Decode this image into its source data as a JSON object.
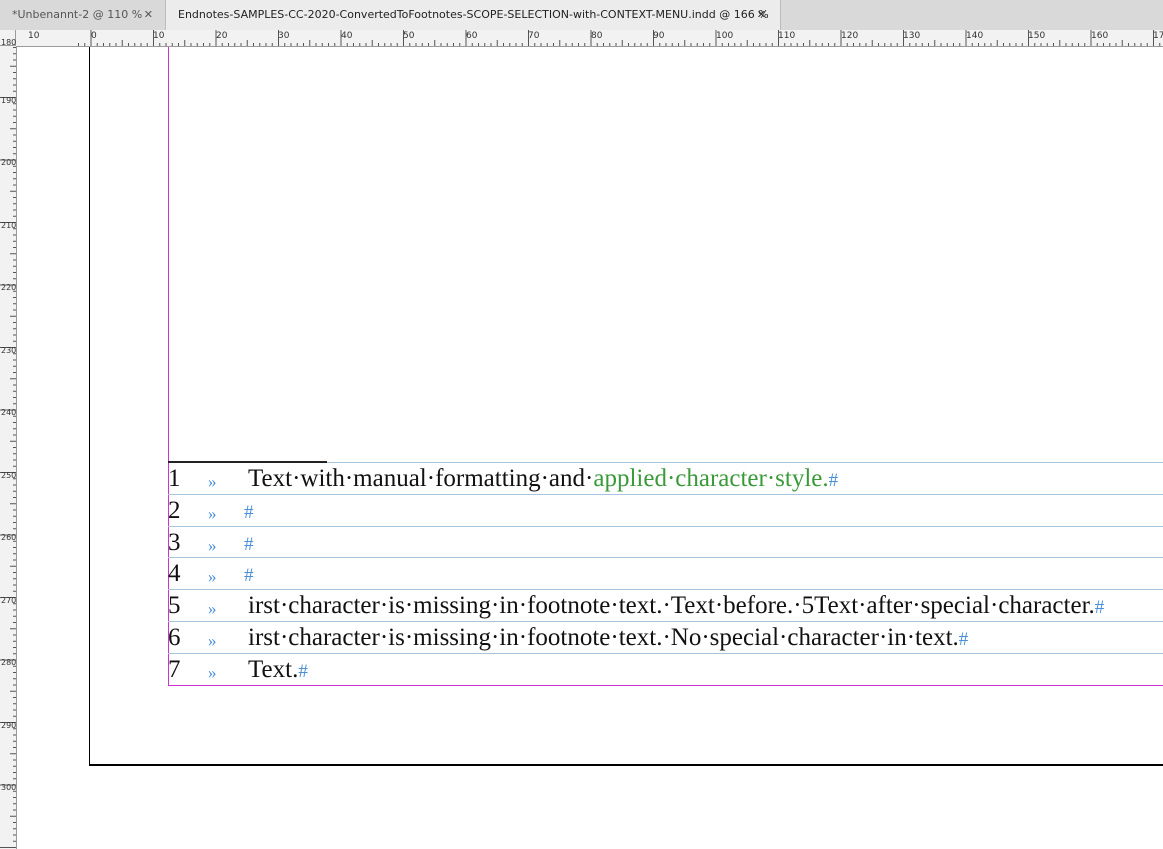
{
  "tabs": [
    {
      "label": "*Unbenannt-2 @ 110 %",
      "close": "✕",
      "active": false
    },
    {
      "label": "Endnotes-SAMPLES-CC-2020-ConvertedToFootnotes-SCOPE-SELECTION-with-CONTEXT-MENU.indd @ 166 %",
      "close": "✕",
      "active": true
    }
  ],
  "rulers": {
    "horizontal_labels": [
      "10",
      "0",
      "10",
      "20",
      "30",
      "40",
      "50",
      "60",
      "70",
      "80",
      "90",
      "100",
      "110",
      "120",
      "130",
      "140",
      "150",
      "160",
      "17"
    ],
    "vertical_labels": [
      "180",
      "190",
      "200",
      "210",
      "220",
      "230",
      "240",
      "250",
      "260",
      "270",
      "280",
      "290",
      "300"
    ]
  },
  "footnotes": [
    {
      "number": "1",
      "tab": "»",
      "text_pre": "Text·with·manual·formatting·and·",
      "text_green": "applied·character·style.",
      "end": "#"
    },
    {
      "number": "2",
      "tab": "»",
      "text_pre": "",
      "text_green": "",
      "end": "#"
    },
    {
      "number": "3",
      "tab": "»",
      "text_pre": "",
      "text_green": "",
      "end": "#"
    },
    {
      "number": "4",
      "tab": "»",
      "text_pre": "",
      "text_green": "",
      "end": "#"
    },
    {
      "number": "5",
      "tab": "»",
      "text_pre": "irst·character·is·missing·in·footnote·text.·Text·before.·5Text·after·special·character.",
      "text_green": "",
      "end": "#"
    },
    {
      "number": "6",
      "tab": "»",
      "text_pre": "irst·character·is·missing·in·footnote·text.·No·special·character·in·text.",
      "text_green": "",
      "end": "#"
    },
    {
      "number": "7",
      "tab": "»",
      "text_pre": "Text.",
      "text_green": "",
      "end": "#"
    }
  ],
  "colors": {
    "character_style_green": "#3a9a3a",
    "hidden_chars_blue": "#4a90d9",
    "margin_guide_magenta": "#cc33cc",
    "baseline_grid": "#a9c4e0"
  }
}
